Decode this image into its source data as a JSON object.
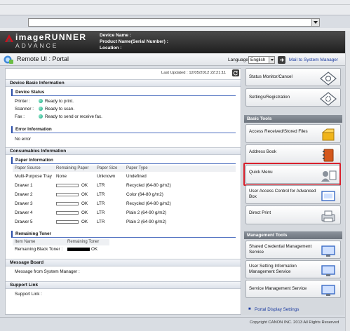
{
  "header": {
    "logo_line1": "imageRUNNER",
    "logo_line2": "ADVANCE",
    "device_name_label": "Device Name :",
    "product_name_label": "Product Name(Serial Number) :",
    "location_label": "Location :"
  },
  "titlebar": {
    "title": "Remote UI : Portal",
    "language_label": "Language",
    "language_value": "English",
    "mail_link": "Mail to System Manager"
  },
  "main": {
    "last_updated": "Last Updated : 12/05/2012 22:21:11",
    "device_basic_info": "Device Basic Information",
    "device_status": {
      "heading": "Device Status",
      "rows": [
        {
          "label": "Printer :",
          "value": "Ready to print."
        },
        {
          "label": "Scanner :",
          "value": "Ready to scan."
        },
        {
          "label": "Fax :",
          "value": "Ready to send or receive fax."
        }
      ]
    },
    "error_info": {
      "heading": "Error Information",
      "text": "No error"
    },
    "consumables_info": "Consumables Information",
    "paper_info": {
      "heading": "Paper Information",
      "columns": [
        "Paper Source",
        "Remaining Paper",
        "Paper Size",
        "Paper Type"
      ],
      "rows": [
        {
          "source": "Multi-Purpose Tray",
          "remaining": "None",
          "bar": false,
          "size": "Unknown",
          "type": "Undefined"
        },
        {
          "source": "Drawer 1",
          "remaining": "OK",
          "bar": true,
          "size": "LTR",
          "type": "Recycled (64-80 g/m2)"
        },
        {
          "source": "Drawer 2",
          "remaining": "OK",
          "bar": true,
          "size": "LTR",
          "type": "Color (64-80 g/m2)"
        },
        {
          "source": "Drawer 3",
          "remaining": "OK",
          "bar": true,
          "size": "LTR",
          "type": "Recycled (64-80 g/m2)"
        },
        {
          "source": "Drawer 4",
          "remaining": "OK",
          "bar": true,
          "size": "LTR",
          "type": "Plain 2 (64-90 g/m2)"
        },
        {
          "source": "Drawer 5",
          "remaining": "OK",
          "bar": true,
          "size": "LTR",
          "type": "Plain 2 (64-90 g/m2)"
        }
      ]
    },
    "remaining_toner": {
      "heading": "Remaining Toner",
      "columns": [
        "Item Name",
        "Remaining Toner"
      ],
      "rows": [
        {
          "name": "Remaining Black Toner :",
          "value": "OK"
        }
      ]
    },
    "message_board": {
      "heading": "Message Board",
      "text": "Message from System Manager :"
    },
    "support_link": {
      "heading": "Support Link",
      "text": "Support Link :"
    }
  },
  "right_panel": {
    "status_monitor": "Status Monitor/Cancel",
    "settings_registration": "Settings/Registration",
    "basic_tools_heading": "Basic Tools",
    "basic_tools": [
      "Access Received/Stored Files",
      "Address Book",
      "Quick Menu",
      "User Access Control for Advanced Box",
      "Direct Print"
    ],
    "management_tools_heading": "Management Tools",
    "management_tools": [
      "Shared Credential Management Service",
      "User Setting Information Management Service",
      "Service Management Service"
    ],
    "portal_display_settings": "Portal Display Settings"
  },
  "footer": {
    "copyright": "Copyright CANON INC. 2013 All Rights Reserved"
  },
  "colors": {
    "accent_blue": "#2b4ea8",
    "highlight_red": "#d8202c",
    "status_green": "#17a884"
  }
}
